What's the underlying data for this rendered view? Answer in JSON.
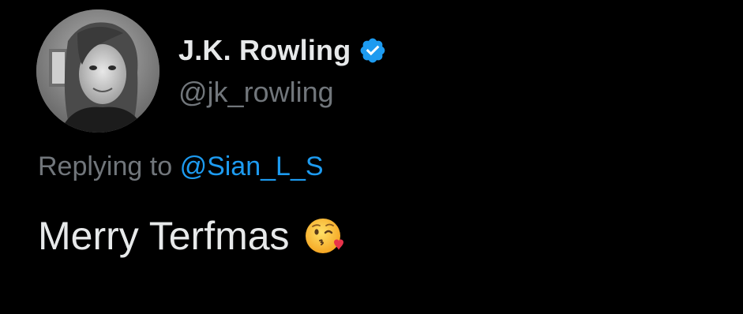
{
  "author": {
    "name": "J.K. Rowling",
    "handle": "@jk_rowling",
    "verified_icon": "verified-badge-icon",
    "verified_color": "#1d9bf0"
  },
  "reply": {
    "prefix": "Replying to",
    "mention": "@Sian_L_S"
  },
  "tweet": {
    "text": "Merry Terfmas",
    "emoji_icon": "face-blowing-kiss-emoji-icon"
  },
  "colors": {
    "background": "#000000",
    "primary_text": "#e7e9ea",
    "secondary_text": "#71767b",
    "link": "#1d9bf0"
  }
}
